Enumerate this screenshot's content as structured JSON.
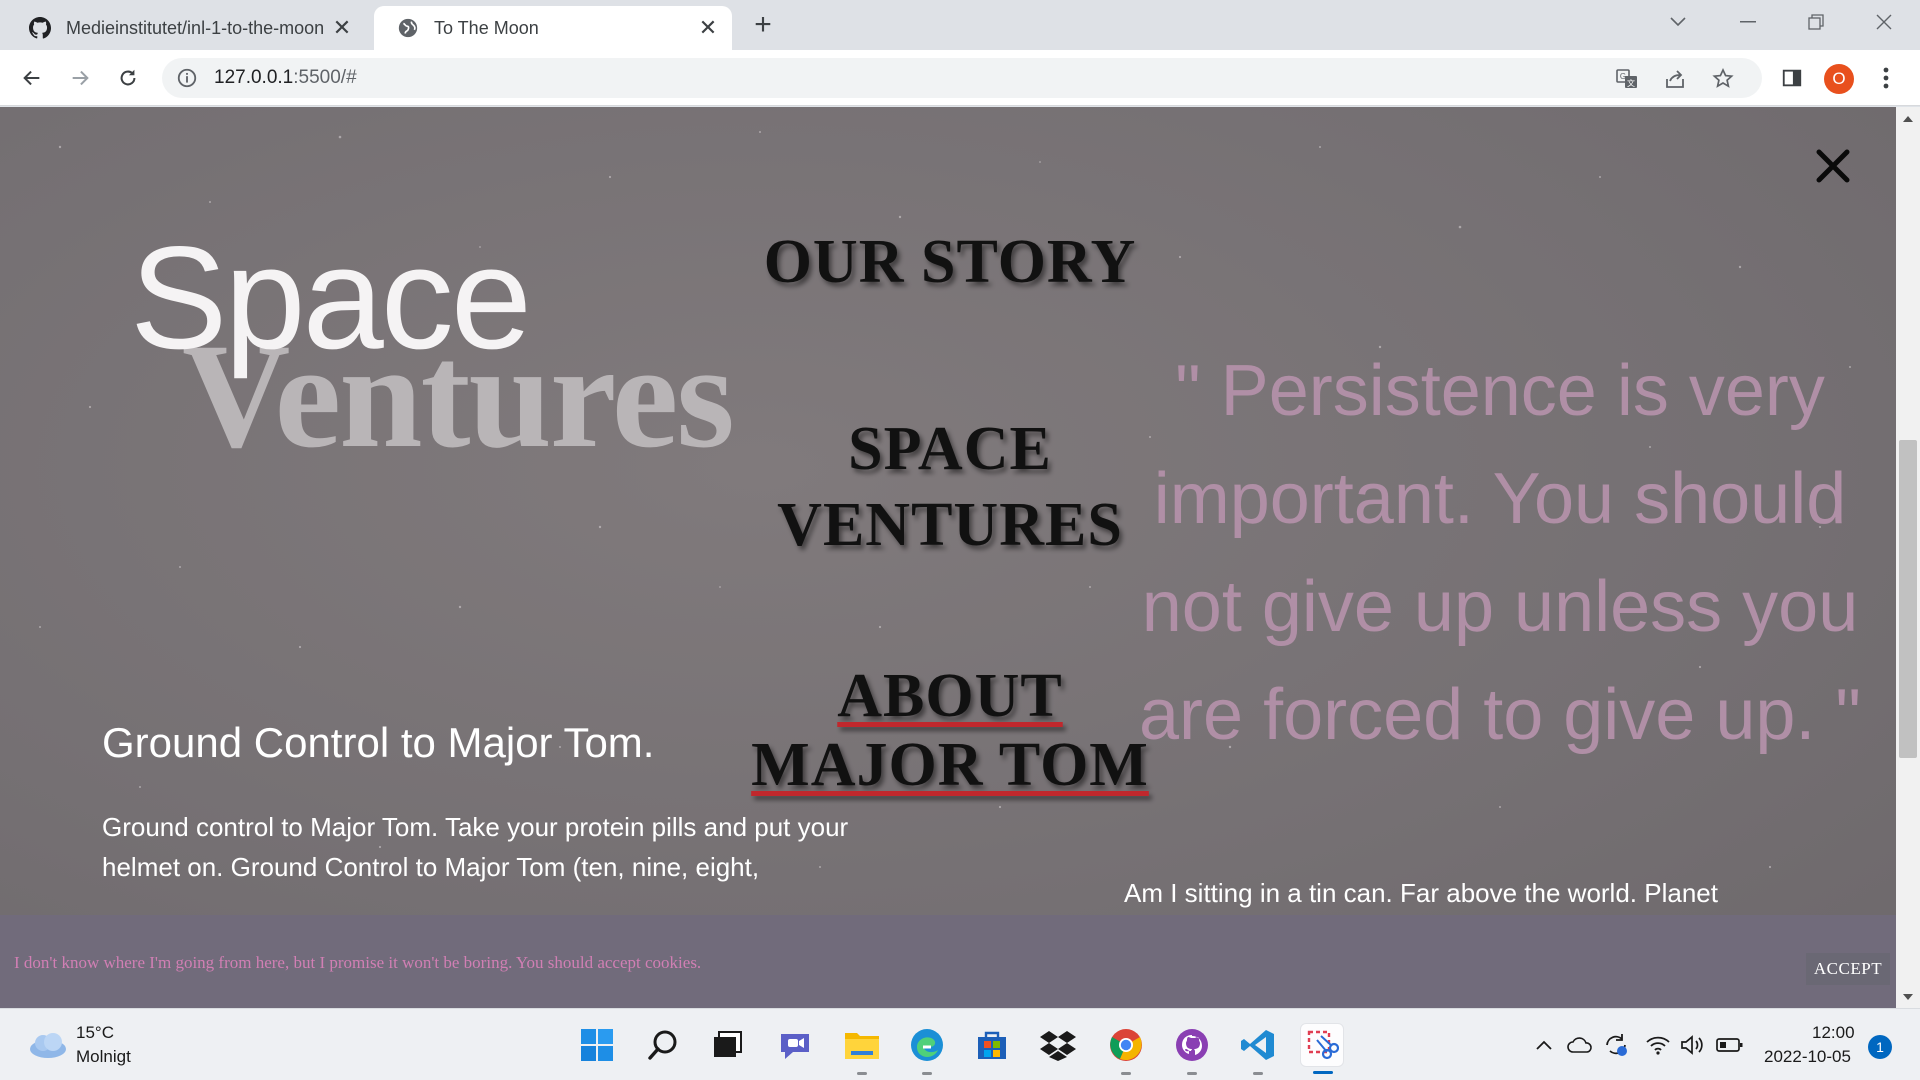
{
  "browser": {
    "tabs": [
      {
        "title": "Medieinstitutet/inl-1-to-the-moon",
        "favicon": "github-icon",
        "active": false
      },
      {
        "title": "To The Moon",
        "favicon": "globe-icon",
        "active": true
      }
    ],
    "url_host": "127.0.0.1",
    "url_rest": ":5500/#",
    "profile_initial": "O"
  },
  "page": {
    "brand_top": "Space",
    "brand_bottom": "Ventures",
    "menu": {
      "our_story_label": "OUR STORY",
      "space_ventures_label": "SPACE VENTURES",
      "about_line1": "ABOUT",
      "about_line2": "MAJOR TOM"
    },
    "quote": "\" Persistence is very important. You should not give up unless you are forced to give up. \"",
    "left_heading": "Ground Control to Major Tom.",
    "left_paragraph": "Ground control to Major Tom. Take your protein pills and put your helmet on. Ground Control to Major Tom (ten, nine, eight,",
    "right_paragraph": "Am I sitting in a tin can. Far above the world. Planet",
    "cookie_text": "I don't know where I'm going from here, but I promise it won't be boring. You should accept cookies.",
    "accept_label": "ACCEPT",
    "colors": {
      "quote": "#b08fa6",
      "cookie_text": "#d17fb4",
      "underline": "#c0282d"
    }
  },
  "taskbar": {
    "weather_temp": "15°C",
    "weather_desc": "Molnigt",
    "clock_time": "12:00",
    "clock_date": "2022-10-05",
    "notification_count": "1",
    "apps": [
      "windows-start-icon",
      "search-icon",
      "task-view-icon",
      "teams-chat-icon",
      "file-explorer-icon",
      "edge-icon",
      "microsoft-store-icon",
      "dropbox-icon",
      "chrome-icon",
      "github-desktop-icon",
      "vscode-icon",
      "snipping-tool-icon"
    ]
  }
}
